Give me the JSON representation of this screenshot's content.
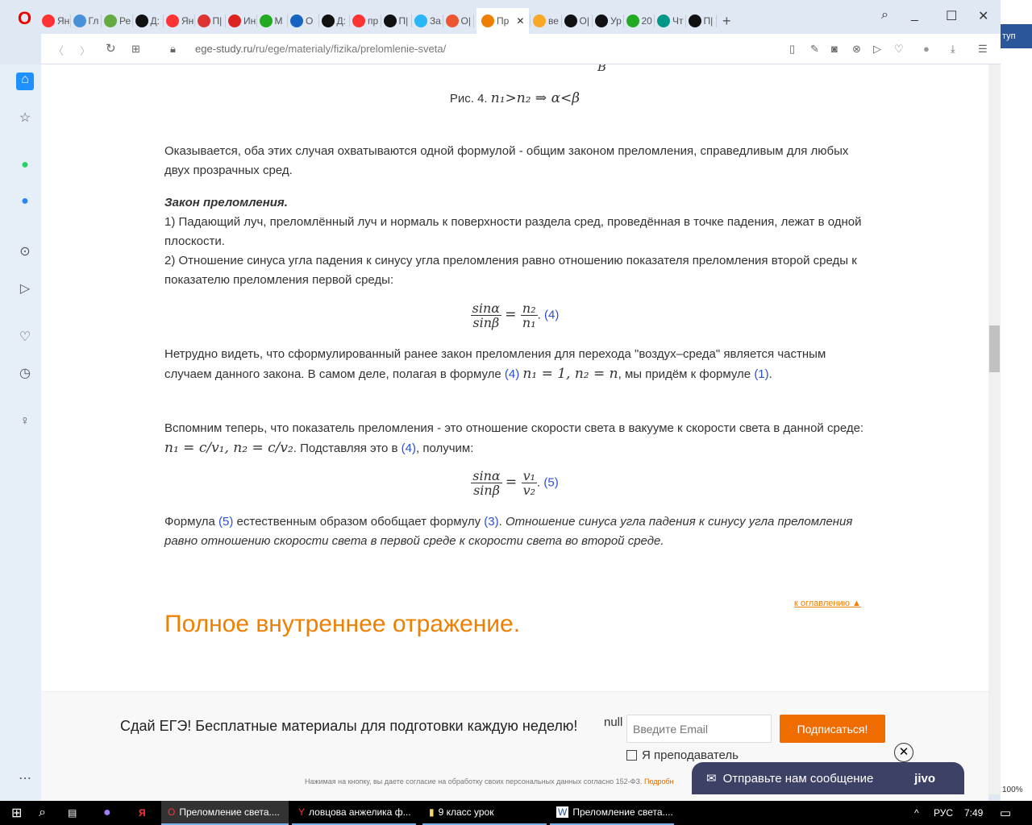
{
  "browser": {
    "tabs": [
      {
        "label": "Ян",
        "color": "#f33"
      },
      {
        "label": "Гл",
        "color": "#4a90d9"
      },
      {
        "label": "Ре",
        "color": "#6a4"
      },
      {
        "label": "Д:",
        "color": "#111"
      },
      {
        "label": "Ян",
        "color": "#f33"
      },
      {
        "label": "П|",
        "color": "#d33"
      },
      {
        "label": "Ин",
        "color": "#d22"
      },
      {
        "label": "М",
        "color": "#2a2"
      },
      {
        "label": "О",
        "color": "#1565c0"
      },
      {
        "label": "Д:",
        "color": "#111"
      },
      {
        "label": "пр",
        "color": "#f33"
      },
      {
        "label": "П|",
        "color": "#111"
      },
      {
        "label": "За",
        "color": "#29b6f6"
      },
      {
        "label": "О|",
        "color": "#e53"
      },
      {
        "label": "Пр",
        "color": "#f07f00",
        "active": true
      },
      {
        "label": "ве",
        "color": "#f9a825"
      },
      {
        "label": "О|",
        "color": "#111"
      },
      {
        "label": "Ур",
        "color": "#111"
      },
      {
        "label": "20",
        "color": "#2a2"
      },
      {
        "label": "Чт",
        "color": "#009688"
      },
      {
        "label": "П|",
        "color": "#111"
      }
    ],
    "new_tab": "+",
    "url_domain": "ege-study.ru",
    "url_path": "/ru/ege/materialy/fizika/prelomlenie-sveta/",
    "zoom": "100%"
  },
  "article": {
    "fig_caption": "Рис. 4.",
    "fig_formula": "n₁>n₂ ⇒ α<β",
    "fig_label": "B",
    "p1": "Оказывается, оба этих случая охватываются одной формулой - общим законом преломления, справедливым для любых двух прозрачных сред.",
    "law_title": "Закон преломления.",
    "law1": "1) Падающий луч, преломлённый луч и нормаль к поверхности раздела сред, проведённая в точке падения, лежат в одной плоскости.",
    "law2": "2) Отношение синуса угла падения к синусу угла преломления равно отношению показателя преломления второй среды к показателю преломления первой среды:",
    "f4": {
      "num_l": "sinα",
      "den_l": "sinβ",
      "num_r": "n₂",
      "den_r": "n₁",
      "ref": "(4)"
    },
    "p2a": "Нетрудно видеть, что сформулированный ранее закон преломления для перехода \"воздух–среда\" является частным случаем данного закона. В самом деле, полагая в формуле ",
    "p2ref": "(4)",
    "p2math": "n₁ = 1, n₂ = n",
    "p2b": ", мы придём к формуле ",
    "p2ref2": "(1)",
    "p2c": ".",
    "p3a": "Вспомним теперь, что показатель преломления - это отношение скорости света в вакууме к скорости света в данной среде: ",
    "p3math": "n₁ = c/v₁, n₂ = c/v₂",
    "p3b": ". Подставляя это в ",
    "p3ref": "(4)",
    "p3c": ", получим:",
    "f5": {
      "num_l": "sinα",
      "den_l": "sinβ",
      "num_r": "v₁",
      "den_r": "v₂",
      "ref": "(5)"
    },
    "p4a": "Формула ",
    "p4ref": "(5)",
    "p4b": " естественным образом обобщает формулу ",
    "p4ref2": "(3)",
    "p4c": ". ",
    "p4i": "Отношение синуса угла падения к синусу угла преломления равно отношению скорости света в первой среде к скорости света во второй среде.",
    "toc_link": "к оглавлению ▲",
    "section_title": "Полное внутреннее отражение."
  },
  "banner": {
    "title": "Сдай ЕГЭ! Бесплатные материалы для подготовки каждую неделю!",
    "null_text": "null",
    "email_placeholder": "Введите Email",
    "subscribe": "Подписаться!",
    "teacher": "Я преподаватель",
    "consent": "Нажимая на кнопку, вы даете согласие на обработку своих персональных данных согласно 152-ФЗ. ",
    "consent_link": "Подробн"
  },
  "jivo": {
    "label": "Отправьте нам сообщение",
    "brand": "jivo"
  },
  "taskbar": {
    "items": [
      "Преломление света....",
      "ловцова анжелика ф...",
      "9 класс урок",
      "Преломление света...."
    ],
    "lang": "РУС",
    "time": "7:49"
  },
  "bg_window": "туп"
}
